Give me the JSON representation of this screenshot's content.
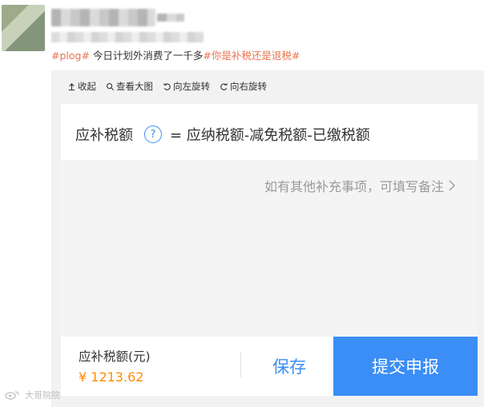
{
  "post": {
    "tag1": "#plog#",
    "text": " 今日计划外消费了一千多",
    "tag2": "#你是补税还是退税#"
  },
  "toolbar": {
    "collapse": "收起",
    "view_large": "查看大图",
    "rotate_left": "向左旋转",
    "rotate_right": "向右旋转"
  },
  "tax": {
    "label": "应补税额",
    "help_glyph": "?",
    "formula": "= 应纳税额-减免税额-已缴税额",
    "note": "如有其他补充事项，可填写备注",
    "due_label": "应补税额(元)",
    "due_amount": "¥ 1213.62",
    "save_label": "保存",
    "submit_label": "提交申报"
  },
  "watermark": {
    "text": "大哥院院"
  },
  "colors": {
    "accent": "#3a8ef6",
    "tag": "#eb7350",
    "amount": "#ff8a00"
  }
}
